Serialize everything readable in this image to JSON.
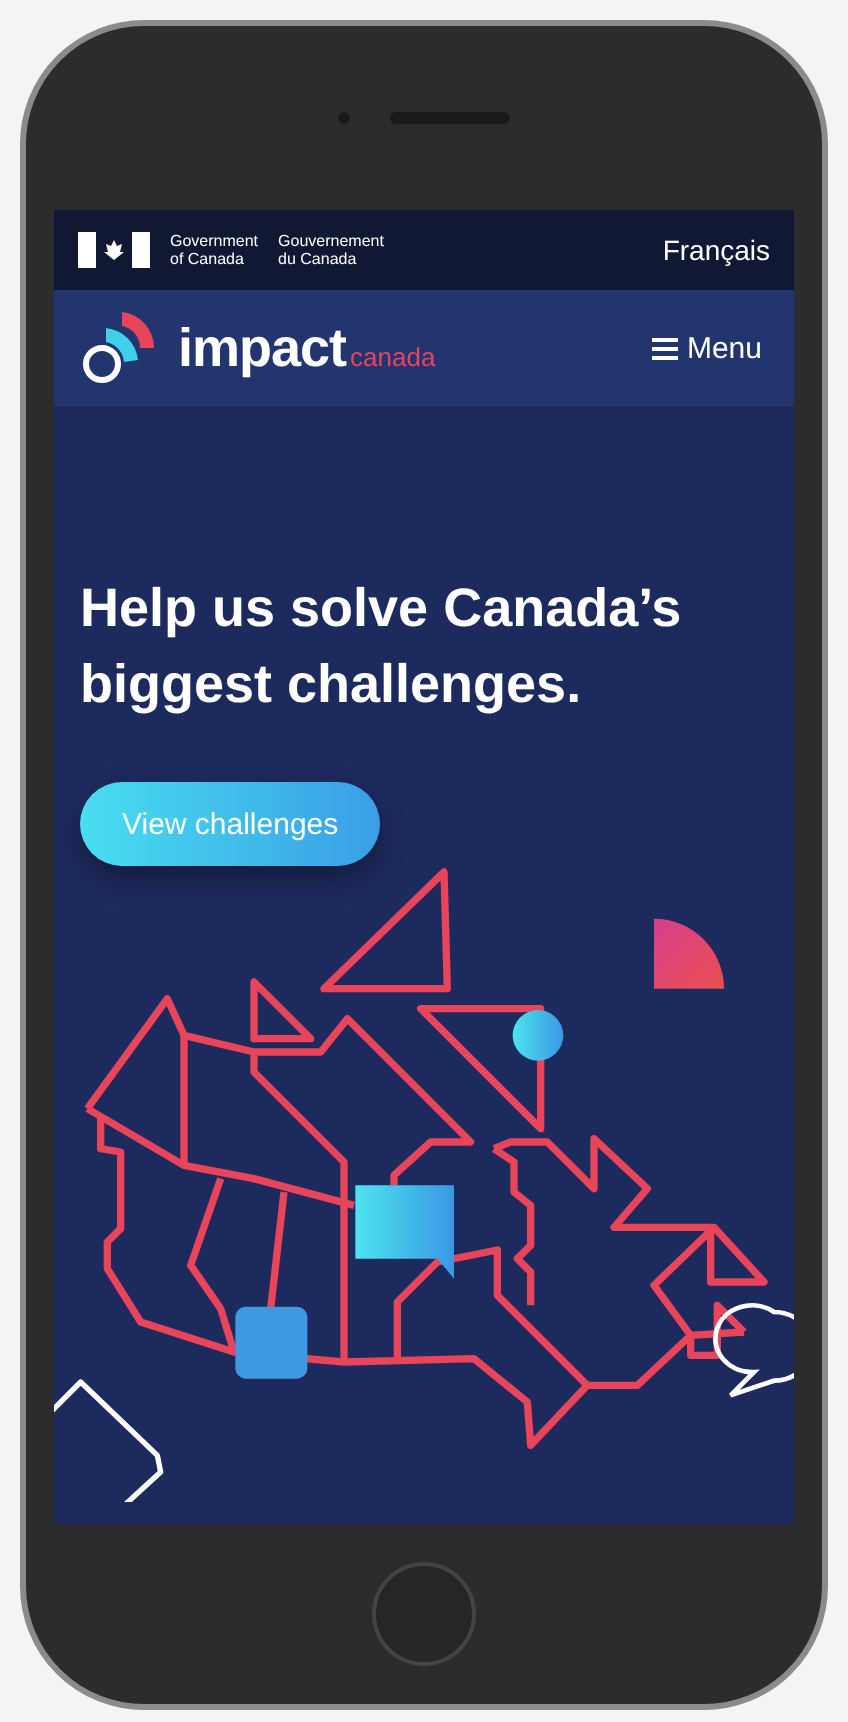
{
  "government_bar": {
    "english_name_lines": [
      "Government",
      "of Canada"
    ],
    "french_name_lines": [
      "Gouvernement",
      "du Canada"
    ],
    "language_link": "Français"
  },
  "header": {
    "logo_word": "impact",
    "logo_subword": "canada",
    "menu_label": "Menu"
  },
  "hero": {
    "headline": "Help us solve Canada’s biggest challenges.",
    "button": "View challenges"
  }
}
